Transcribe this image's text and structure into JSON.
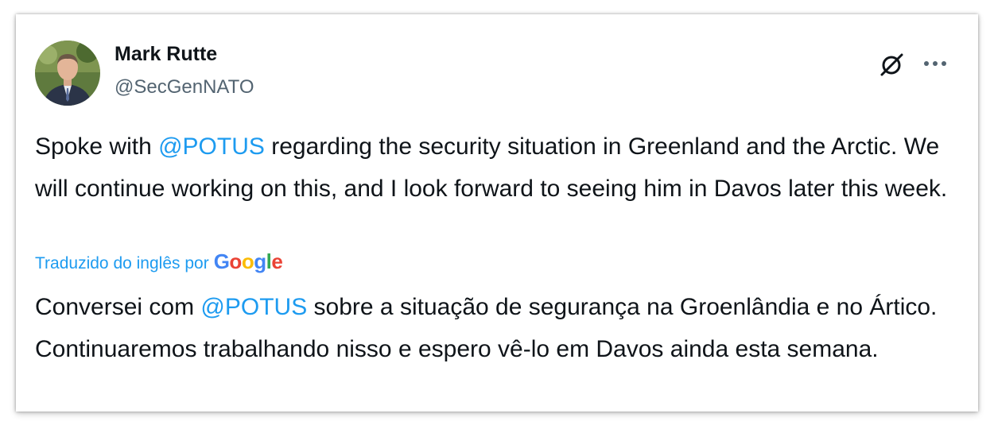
{
  "tweet": {
    "author_name": "Mark Rutte",
    "handle": "@SecGenNATO",
    "original": {
      "before_mention": "Spoke with ",
      "mention": "@POTUS",
      "after_mention": " regarding the security situation in Greenland and the Arctic.  We will continue working on this, and I look forward to seeing him in Davos later this week."
    },
    "translated_by_label": "Traduzido do inglês por",
    "translator_logo_letters": [
      "G",
      "o",
      "o",
      "g",
      "l",
      "e"
    ],
    "translation": {
      "before_mention": "Conversei com ",
      "mention": "@POTUS",
      "after_mention": " sobre a situação de segurança na Groenlândia e no Ártico. Continuaremos trabalhando nisso e espero vê-lo em Davos ainda esta semana."
    }
  },
  "icons": {
    "grok": "grok-icon",
    "more": "more-options-icon",
    "avatar": "profile-photo"
  },
  "colors": {
    "link": "#1d9bf0",
    "text": "#0f1419",
    "secondary": "#536471",
    "google_blue": "#4285f4",
    "google_red": "#ea4335",
    "google_yellow": "#fbbc05",
    "google_green": "#34a853"
  }
}
